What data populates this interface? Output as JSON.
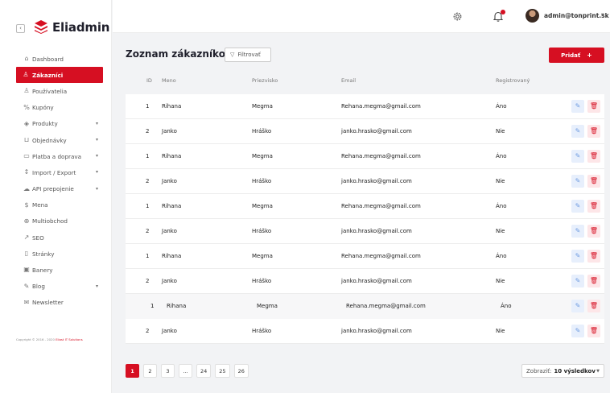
{
  "brand": {
    "name": "Eliadmin",
    "collapse_icon": "chevron-left-icon"
  },
  "sidebar": {
    "items": [
      {
        "label": "Dashboard",
        "icon": "dashboard-icon",
        "glyph": "⌂",
        "active": false,
        "has_chevron": false
      },
      {
        "label": "Zákazníci",
        "icon": "user-icon",
        "glyph": "♙",
        "active": true,
        "has_chevron": false
      },
      {
        "label": "Používatelia",
        "icon": "user-icon",
        "glyph": "♙",
        "active": false,
        "has_chevron": false
      },
      {
        "label": "Kupóny",
        "icon": "percent-icon",
        "glyph": "%",
        "active": false,
        "has_chevron": false
      },
      {
        "label": "Produkty",
        "icon": "box-icon",
        "glyph": "◈",
        "active": false,
        "has_chevron": true
      },
      {
        "label": "Objednávky",
        "icon": "cart-icon",
        "glyph": "⊔",
        "active": false,
        "has_chevron": true
      },
      {
        "label": "Platba a doprava",
        "icon": "card-icon",
        "glyph": "▭",
        "active": false,
        "has_chevron": true
      },
      {
        "label": "Import / Export",
        "icon": "import-export-icon",
        "glyph": "↕",
        "active": false,
        "has_chevron": true
      },
      {
        "label": "API prepojenie",
        "icon": "cloud-icon",
        "glyph": "☁",
        "active": false,
        "has_chevron": true
      },
      {
        "label": "Mena",
        "icon": "currency-icon",
        "glyph": "$",
        "active": false,
        "has_chevron": false
      },
      {
        "label": "Multiobchod",
        "icon": "globe-icon",
        "glyph": "⊕",
        "active": false,
        "has_chevron": false
      },
      {
        "label": "SEO",
        "icon": "trend-icon",
        "glyph": "↗",
        "active": false,
        "has_chevron": false
      },
      {
        "label": "Stránky",
        "icon": "page-icon",
        "glyph": "▯",
        "active": false,
        "has_chevron": false
      },
      {
        "label": "Banery",
        "icon": "image-icon",
        "glyph": "▣",
        "active": false,
        "has_chevron": false
      },
      {
        "label": "Blog",
        "icon": "pencil-icon",
        "glyph": "✎",
        "active": false,
        "has_chevron": true
      },
      {
        "label": "Newsletter",
        "icon": "mail-icon",
        "glyph": "✉",
        "active": false,
        "has_chevron": false
      }
    ],
    "copyright_prefix": "Copyright © 2016 - 2020 ",
    "copyright_company": "Eliast IT Solutions"
  },
  "topbar": {
    "user": "admin@tonprint.sk"
  },
  "page": {
    "title": "Zoznam zákazníkov",
    "filter_label": "Filtrovať",
    "add_label": "Pridať",
    "add_plus": "+"
  },
  "table": {
    "headers": {
      "id": "ID",
      "name": "Meno",
      "surname": "Priezvisko",
      "email": "Email",
      "registered": "Registrovaný"
    },
    "rows": [
      {
        "id": "1",
        "name": "Rihana",
        "surname": "Megma",
        "email": "Rehana.megma@gmail.com",
        "registered": "Áno"
      },
      {
        "id": "2",
        "name": "Janko",
        "surname": "Hráško",
        "email": "janko.hrasko@gmail.com",
        "registered": "Nie"
      },
      {
        "id": "1",
        "name": "Rihana",
        "surname": "Megma",
        "email": "Rehana.megma@gmail.com",
        "registered": "Áno"
      },
      {
        "id": "2",
        "name": "Janko",
        "surname": "Hráško",
        "email": "janko.hrasko@gmail.com",
        "registered": "Nie"
      },
      {
        "id": "1",
        "name": "Rihana",
        "surname": "Megma",
        "email": "Rehana.megma@gmail.com",
        "registered": "Áno"
      },
      {
        "id": "2",
        "name": "Janko",
        "surname": "Hráško",
        "email": "janko.hrasko@gmail.com",
        "registered": "Nie"
      },
      {
        "id": "1",
        "name": "Rihana",
        "surname": "Megma",
        "email": "Rehana.megma@gmail.com",
        "registered": "Áno"
      },
      {
        "id": "2",
        "name": "Janko",
        "surname": "Hráško",
        "email": "janko.hrasko@gmail.com",
        "registered": "Nie"
      },
      {
        "id": "1",
        "name": "Rihana",
        "surname": "Megma",
        "email": "Rehana.megma@gmail.com",
        "registered": "Áno",
        "hovered": true
      },
      {
        "id": "2",
        "name": "Janko",
        "surname": "Hráško",
        "email": "janko.hrasko@gmail.com",
        "registered": "Nie"
      }
    ]
  },
  "pagination": {
    "pages": [
      "1",
      "2",
      "3",
      "...",
      "24",
      "25",
      "26"
    ],
    "active": "1",
    "per_page_label": "Zobraziť:",
    "per_page_value": "10 výsledkov"
  },
  "colors": {
    "accent": "#d60f22",
    "edit": "#6f9be0"
  }
}
